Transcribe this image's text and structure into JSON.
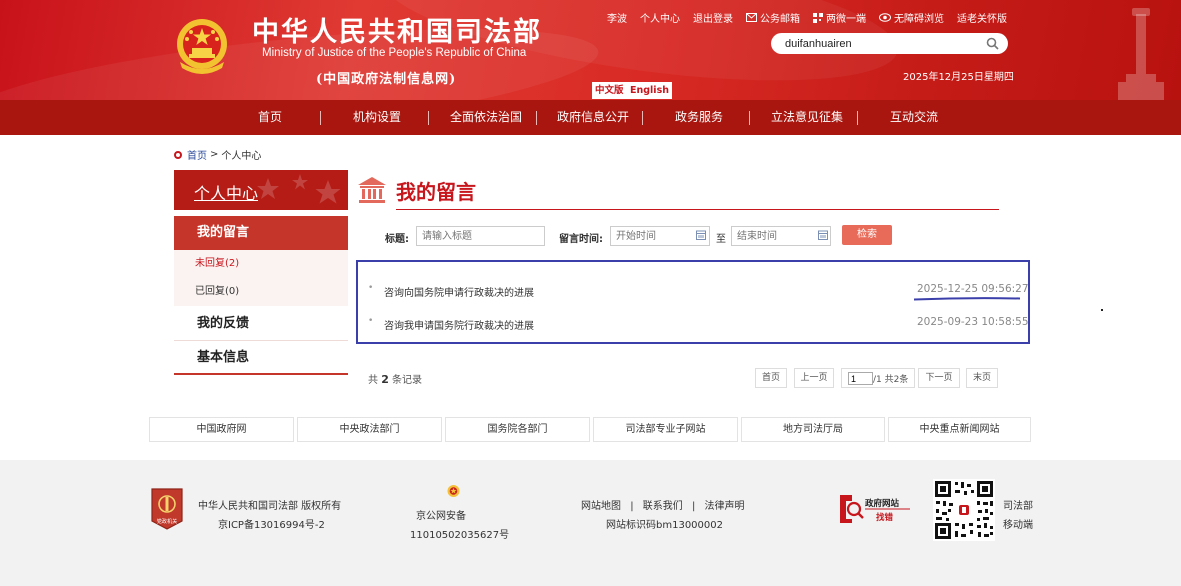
{
  "header": {
    "site_title": "中华人民共和国司法部",
    "site_title_en": "Ministry of Justice of the People's Republic of China",
    "site_subtitle": "(中国政府法制信息网)",
    "lang_cn": "中文版",
    "lang_en": "English",
    "top_links": {
      "user": "李波",
      "personal_center": "个人中心",
      "logout": "退出登录",
      "mail": "公务邮箱",
      "two_micro": "两微一端",
      "accessible": "无障碍浏览",
      "elderly": "适老关怀版"
    },
    "search_value": "duifanhuairen",
    "date": "2025年12月25日星期四"
  },
  "nav": {
    "items": [
      "首页",
      "机构设置",
      "全面依法治国",
      "政府信息公开",
      "政务服务",
      "立法意见征集",
      "互动交流"
    ]
  },
  "breadcrumb": {
    "home": "首页",
    "sep": ">",
    "current": "个人中心"
  },
  "sidebar": {
    "header": "个人中心",
    "active": "我的留言",
    "unreplied": "未回复(2)",
    "replied": "已回复(0)",
    "feedback": "我的反馈",
    "basic_info": "基本信息"
  },
  "content": {
    "title": "我的留言",
    "filters": {
      "title_label": "标题:",
      "title_placeholder": "请输入标题",
      "time_label": "留言时间:",
      "start_placeholder": "开始时间",
      "to": "至",
      "end_placeholder": "结束时间",
      "search_button": "检索"
    },
    "messages": [
      {
        "title": "咨询向国务院申请行政裁决的进展",
        "time": "2025-12-25 09:56:27"
      },
      {
        "title": "咨询我申请国务院行政裁决的进展",
        "time": "2025-09-23 10:58:55"
      }
    ],
    "count_prefix": "共",
    "count": "2",
    "count_suffix": "条记录",
    "pagination": {
      "first": "首页",
      "prev": "上一页",
      "page_value": "1",
      "page_info": "/1 共2条",
      "next": "下一页",
      "last": "末页"
    }
  },
  "links": [
    "中国政府网",
    "中央政法部门",
    "国务院各部门",
    "司法部专业子网站",
    "地方司法厅局",
    "中央重点新闻网站"
  ],
  "footer": {
    "copyright": "中华人民共和国司法部 版权所有",
    "icp": "京ICP备13016994号-2",
    "police_label": "京公网安备",
    "police_number": "11010502035627号",
    "sitemap": "网站地图",
    "contact": "联系我们",
    "legal": "法律声明",
    "sep": "|",
    "site_id": "网站标识码bm13000002",
    "gov_site_line1": "政府网站",
    "gov_site_line2": "找错",
    "mobile_line1": "司法部",
    "mobile_line2": "移动端",
    "badge_text": "党政机关"
  },
  "colors": {
    "header_red": "#c8121a",
    "nav_red": "#a8160f",
    "accent_red": "#c8161d",
    "highlight_border": "#3b3faa",
    "search_button": "#e86a58"
  }
}
